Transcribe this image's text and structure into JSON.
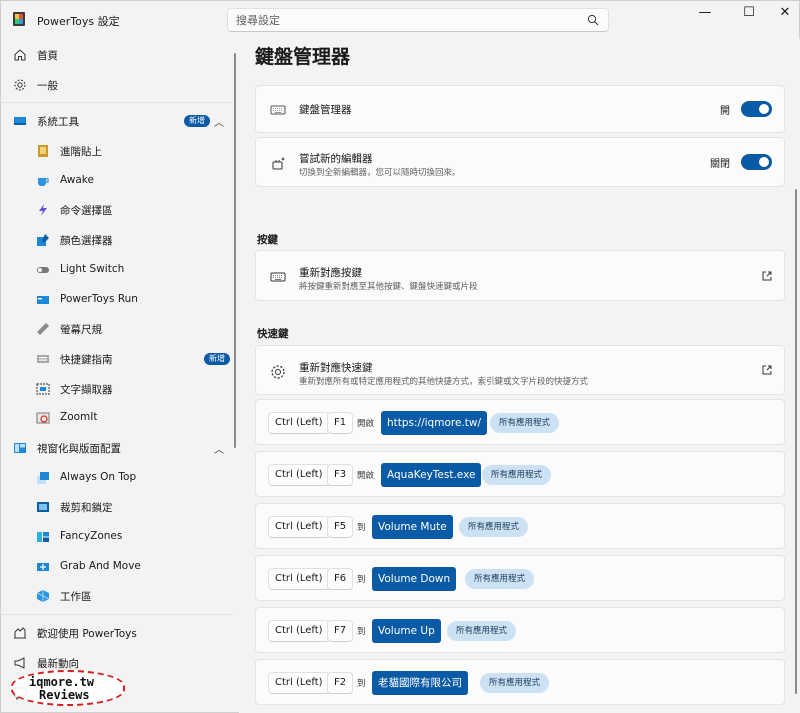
{
  "titlebar": {
    "app_title": "PowerToys 設定",
    "search_placeholder": "搜尋設定",
    "minimize": "—",
    "maximize": "☐",
    "close": "✕"
  },
  "sidebar": {
    "home": "首頁",
    "general": "一般",
    "system_tools": {
      "label": "系統工具",
      "badge": "新增"
    },
    "system_items": [
      {
        "label": "進階貼上",
        "icon": "advanced-paste-icon"
      },
      {
        "label": "Awake",
        "icon": "awake-cup-icon"
      },
      {
        "label": "命令選擇區",
        "icon": "command-palette-icon"
      },
      {
        "label": "顏色選擇器",
        "icon": "color-picker-icon"
      },
      {
        "label": "Light Switch",
        "icon": "light-switch-icon"
      },
      {
        "label": "PowerToys Run",
        "icon": "powertoys-run-icon"
      },
      {
        "label": "螢幕尺規",
        "icon": "screen-ruler-icon"
      },
      {
        "label": "快捷鍵指南",
        "icon": "shortcut-guide-icon",
        "badge": "新增"
      },
      {
        "label": "文字擷取器",
        "icon": "text-extractor-icon"
      },
      {
        "label": "ZoomIt",
        "icon": "zoomit-icon"
      }
    ],
    "windowing": {
      "label": "視窗化與版面配置"
    },
    "windowing_items": [
      {
        "label": "Always On Top",
        "icon": "always-on-top-icon"
      },
      {
        "label": "裁剪和鎖定",
        "icon": "crop-and-lock-icon"
      },
      {
        "label": "FancyZones",
        "icon": "fancyzones-icon"
      },
      {
        "label": "Grab And Move",
        "icon": "grab-and-move-icon"
      },
      {
        "label": "工作區",
        "icon": "workspaces-icon"
      }
    ],
    "welcome": "歡迎使用 PowerToys",
    "whats_new": "最新動向"
  },
  "main": {
    "page_title": "鍵盤管理器",
    "enable_card": {
      "title": "鍵盤管理器",
      "toggle_label": "開"
    },
    "new_editor_card": {
      "title": "嘗試新的編輯器",
      "subtitle": "切換到全新編輯器，您可以隨時切換回來。",
      "toggle_label": "關閉"
    },
    "keys_section": "按鍵",
    "remap_keys_card": {
      "title": "重新對應按鍵",
      "subtitle": "將按鍵重新對應至其他按鍵、鍵盤快速鍵或片段"
    },
    "shortcuts_section": "快速鍵",
    "remap_shortcuts_card": {
      "title": "重新對應快速鍵",
      "subtitle": "重新對應所有或特定應用程式的其他快捷方式，索引鍵或文字片段的快捷方式"
    },
    "mappings": [
      {
        "mod": "Ctrl (Left)",
        "key": "F1",
        "action": "開啟",
        "target": "https://iqmore.tw/",
        "scope": "所有應用程式"
      },
      {
        "mod": "Ctrl (Left)",
        "key": "F3",
        "action": "開啟",
        "target": "AquaKeyTest.exe",
        "scope": "所有應用程式"
      },
      {
        "mod": "Ctrl (Left)",
        "key": "F5",
        "action": "到",
        "target": "Volume Mute",
        "scope": "所有應用程式"
      },
      {
        "mod": "Ctrl (Left)",
        "key": "F6",
        "action": "到",
        "target": "Volume Down",
        "scope": "所有應用程式"
      },
      {
        "mod": "Ctrl (Left)",
        "key": "F7",
        "action": "到",
        "target": "Volume Up",
        "scope": "所有應用程式"
      },
      {
        "mod": "Ctrl (Left)",
        "key": "F2",
        "action": "到",
        "target": "老貓國際有限公司",
        "scope": "所有應用程式"
      }
    ]
  },
  "watermark": {
    "line1": "iqmore.tw",
    "line2": "Reviews"
  },
  "colors": {
    "accent": "#0a5aa6",
    "scope_pill": "#cce2f4",
    "background": "#f3f3f3",
    "card": "#fbfbfb"
  }
}
